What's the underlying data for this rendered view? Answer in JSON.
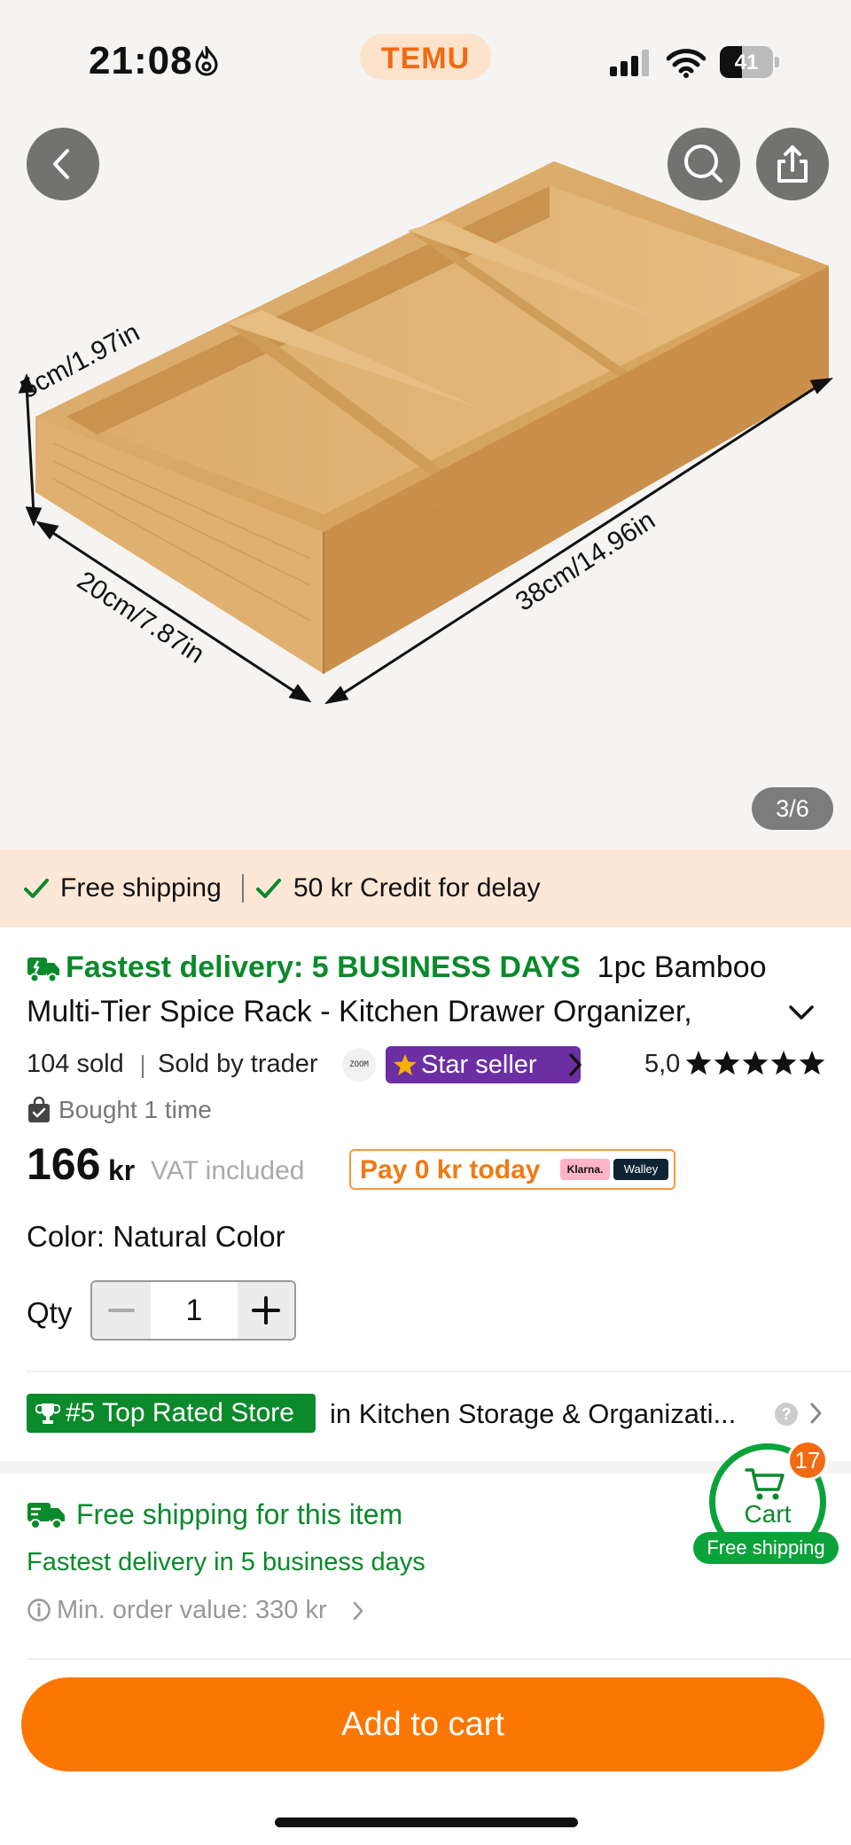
{
  "status_bar": {
    "time": "21:08",
    "brand_pill": "TEMU",
    "battery": "41",
    "battery_fraction": 0.41
  },
  "gallery": {
    "page_indicator": "3/6",
    "dimension_labels": {
      "height": "5cm/1.97in",
      "width": "20cm/7.87in",
      "length": "38cm/14.96in"
    }
  },
  "shipping_banner": {
    "free_shipping": "Free shipping",
    "credit": "50 kr Credit for delay"
  },
  "product": {
    "fastest_delivery": "Fastest delivery: 5 BUSINESS DAYS",
    "title_part1": "1pc Bamboo",
    "title_part2": "Multi-Tier Spice Rack - Kitchen Drawer Organizer,",
    "sold": "104 sold",
    "sold_by": "Sold by trader",
    "store_logo": "ZOOM",
    "star_seller": "Star seller",
    "rating": "5,0",
    "rating_stars": 5,
    "bought": "Bought 1 time",
    "price": "166",
    "currency": "kr",
    "vat": "VAT included",
    "pay_today": "Pay 0 kr today",
    "klarna": "Klarna.",
    "walley": "Walley",
    "color": "Color: Natural Color",
    "qty_label": "Qty",
    "qty_value": "1"
  },
  "ranking": {
    "badge": "#5 Top Rated Store",
    "category": "in Kitchen Storage & Organizati..."
  },
  "shipping_info": {
    "title": "Free shipping for this item",
    "fastest": "Fastest delivery in 5 business days",
    "min_order": "Min. order value: 330 kr"
  },
  "floating_cart": {
    "label": "Cart",
    "count": "17",
    "free_shipping": "Free shipping"
  },
  "cta": {
    "add_to_cart": "Add to cart"
  },
  "colors": {
    "accent_orange": "#fb7701",
    "green": "#0a8a2a",
    "star_seller_purple": "#6b2fa3"
  }
}
